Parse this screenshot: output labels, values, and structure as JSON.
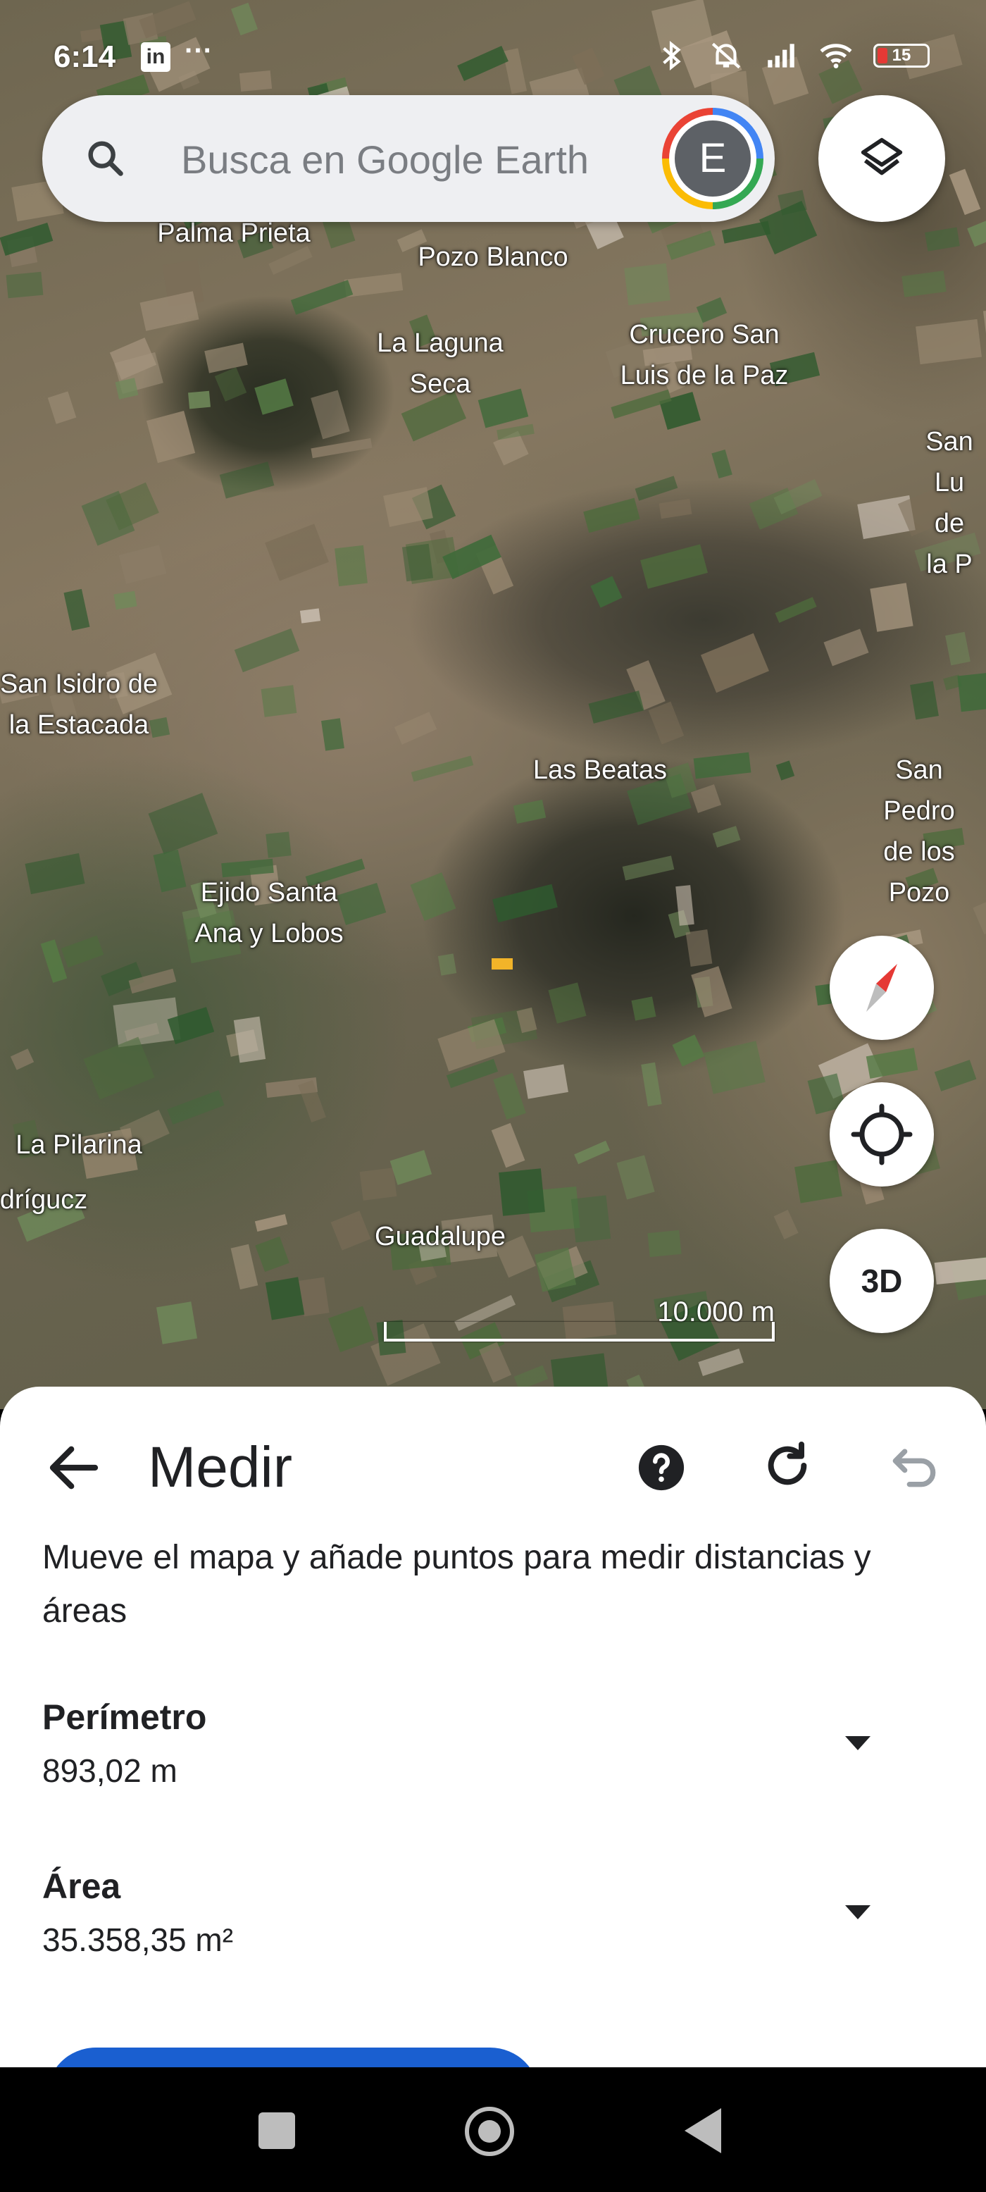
{
  "status_bar": {
    "time": "6:14",
    "linkedin_icon": "linkedin-icon",
    "overflow": "···",
    "battery_level": "15"
  },
  "search": {
    "placeholder": "Busca en Google Earth",
    "avatar_letter": "E"
  },
  "map": {
    "places": [
      "Palma Prieta",
      "Pozo Blanco",
      "La Laguna\nSeca",
      "Crucero San\nLuis de la Paz",
      "San Lu\nde la P",
      "San Isidro de\nla Estacada",
      "Las Beatas",
      "San Pedro\nde los Pozo",
      "Ejido Santa\nAna y Lobos",
      "La Pilarina",
      "drígucz",
      "Guadalupe"
    ],
    "scale_label": "10.000 m",
    "button_3d": "3D"
  },
  "sheet": {
    "title": "Medir",
    "description": "Mueve el mapa y añade puntos para medir distancias y áreas",
    "perimeter_label": "Perímetro",
    "perimeter_value": "893,02 m",
    "area_label": "Área",
    "area_value": "35.358,35 m²"
  },
  "colors": {
    "accent": "#1a5fd0",
    "sheet_bg": "#ffffff",
    "text": "#202124"
  }
}
